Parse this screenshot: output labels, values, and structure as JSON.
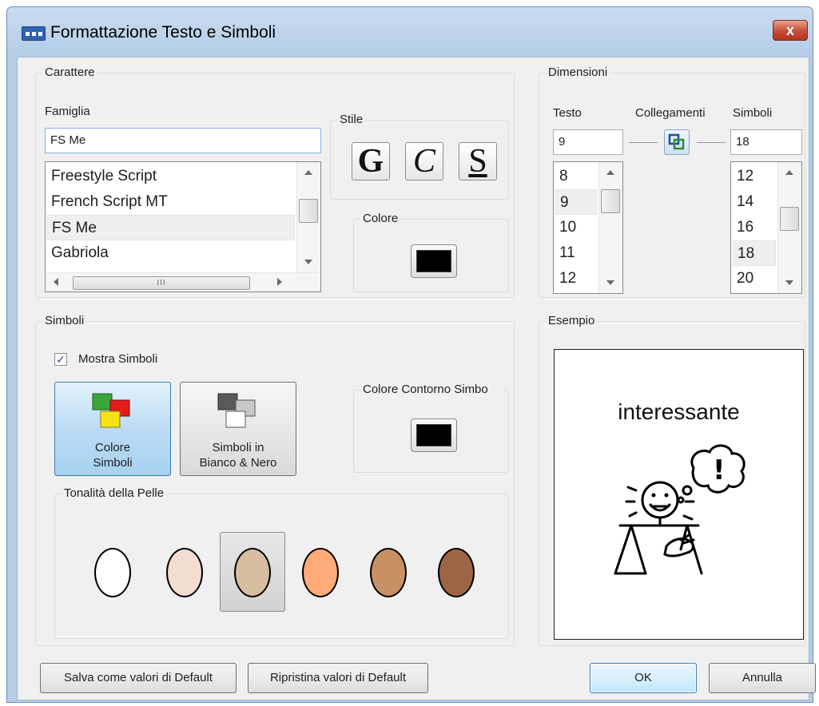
{
  "window": {
    "title": "Formattazione Testo e Simboli",
    "close_glyph": "x"
  },
  "carattere": {
    "group_label": "Carattere",
    "famiglia_label": "Famiglia",
    "font_value": "FS Me",
    "font_list": [
      "Freestyle Script",
      "French Script MT",
      "FS Me",
      "Gabriola"
    ],
    "selected_font": "FS Me",
    "stile_label": "Stile",
    "style_buttons": {
      "bold": "G",
      "italic": "C",
      "underline": "S"
    },
    "colore_label": "Colore",
    "text_color": "#000000",
    "hscroll_grip": "III"
  },
  "dimensioni": {
    "group_label": "Dimensioni",
    "testo_label": "Testo",
    "collegamenti_label": "Collegamenti",
    "simboli_label": "Simboli",
    "testo_value": "9",
    "simboli_value": "18",
    "testo_list": [
      "8",
      "9",
      "10",
      "11",
      "12"
    ],
    "testo_selected": "9",
    "simboli_list": [
      "12",
      "14",
      "16",
      "18",
      "20"
    ],
    "simboli_selected": "18",
    "link_icon": "link-icon"
  },
  "simboli": {
    "group_label": "Simboli",
    "mostra_label": "Mostra Simboli",
    "mostra_checked": true,
    "check_glyph": "✓",
    "colore_simboli_label_1": "Colore",
    "colore_simboli_label_2": "Simboli",
    "bianco_nero_label_1": "Simboli in",
    "bianco_nero_label_2": "Bianco & Nero",
    "contorno_label": "Colore Contorno Simbo",
    "contorno_color": "#000000",
    "tonalita_label": "Tonalità della Pelle",
    "skin_tones": [
      "#ffffff",
      "#f2ddd0",
      "#d8bea0",
      "#ffab79",
      "#c89164",
      "#9c6646"
    ],
    "skin_selected": 2
  },
  "esempio": {
    "group_label": "Esempio",
    "word": "interessante"
  },
  "buttons": {
    "save_defaults": "Salva come valori di Default",
    "restore_defaults": "Ripristina valori di Default",
    "ok": "OK",
    "cancel": "Annulla"
  }
}
